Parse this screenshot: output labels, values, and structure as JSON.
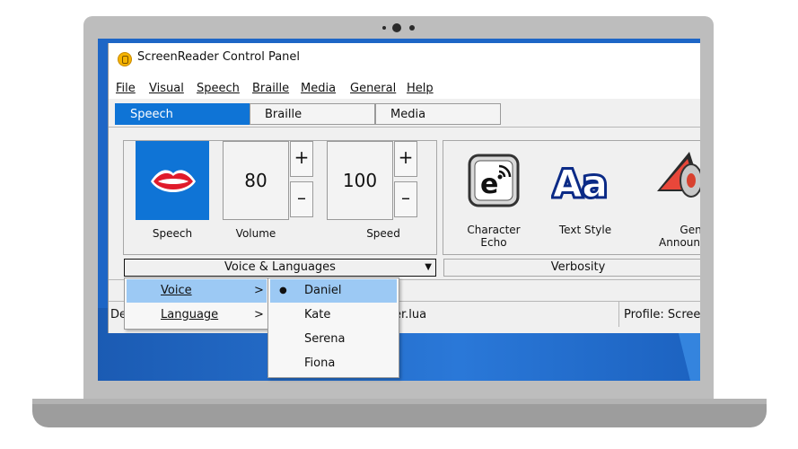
{
  "window": {
    "title": "ScreenReader Control Panel"
  },
  "menu": [
    "File",
    "Visual",
    "Speech",
    "Braille",
    "Media",
    "General",
    "Help"
  ],
  "tabs": [
    "Speech",
    "Braille",
    "Media"
  ],
  "speech_group": {
    "speech_label": "Speech",
    "volume": {
      "value": "80",
      "label": "Volume"
    },
    "speed": {
      "value": "100",
      "label": "Speed"
    },
    "plus": "+",
    "minus": "–",
    "dropdown": "Voice & Languages",
    "dropdown_arrow": "▼"
  },
  "verbosity_group": {
    "items": [
      {
        "label1": "Character",
        "label2": "Echo"
      },
      {
        "label1": "Text Style",
        "label2": ""
      },
      {
        "label1": "Gener",
        "label2": "Announce"
      }
    ],
    "dropdown": "Verbosity"
  },
  "status": {
    "left": "De",
    "middle": "er.lua",
    "right": "Profile: Scree"
  },
  "context_menu": {
    "items": [
      {
        "label": "Voice",
        "arrow": ">"
      },
      {
        "label": "Language",
        "arrow": ">"
      }
    ]
  },
  "voice_submenu": {
    "selected_mark": "●",
    "items": [
      "Daniel",
      "Kate",
      "Serena",
      "Fiona"
    ],
    "selected": "Daniel"
  },
  "colors": {
    "accent": "#0f74d6",
    "highlight": "#9cc9f4",
    "desktop": "#1e66c6"
  },
  "icons": [
    "lips-icon",
    "character-echo-icon",
    "text-style-icon",
    "announcement-megaphone-icon",
    "app-icon"
  ]
}
